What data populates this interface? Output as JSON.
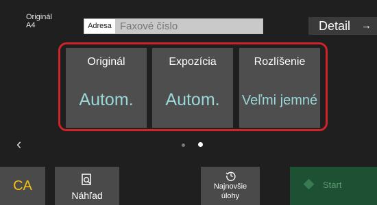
{
  "header": {
    "original_label": "Originál",
    "original_size": "A4",
    "address_label": "Adresa",
    "address_placeholder": "Faxové číslo",
    "detail_label": "Detail",
    "detail_arrow": "→"
  },
  "tiles": [
    {
      "title": "Originál",
      "value": "Autom."
    },
    {
      "title": "Expozícia",
      "value": "Autom."
    },
    {
      "title": "Rozlíšenie",
      "value": "Veľmi jemné"
    }
  ],
  "pager": {
    "prev_arrow": "‹",
    "pages": 2,
    "active_page": 2
  },
  "footer": {
    "ca_label": "CA",
    "preview_label": "Náhľad",
    "recent_jobs_label_line1": "Najnovšie",
    "recent_jobs_label_line2": "úlohy",
    "start_label": "Start"
  },
  "colors": {
    "highlight_border": "#d1232a",
    "tile_value": "#9bd6d8",
    "ca_text": "#f4c012",
    "start_bg": "#1e5134"
  }
}
